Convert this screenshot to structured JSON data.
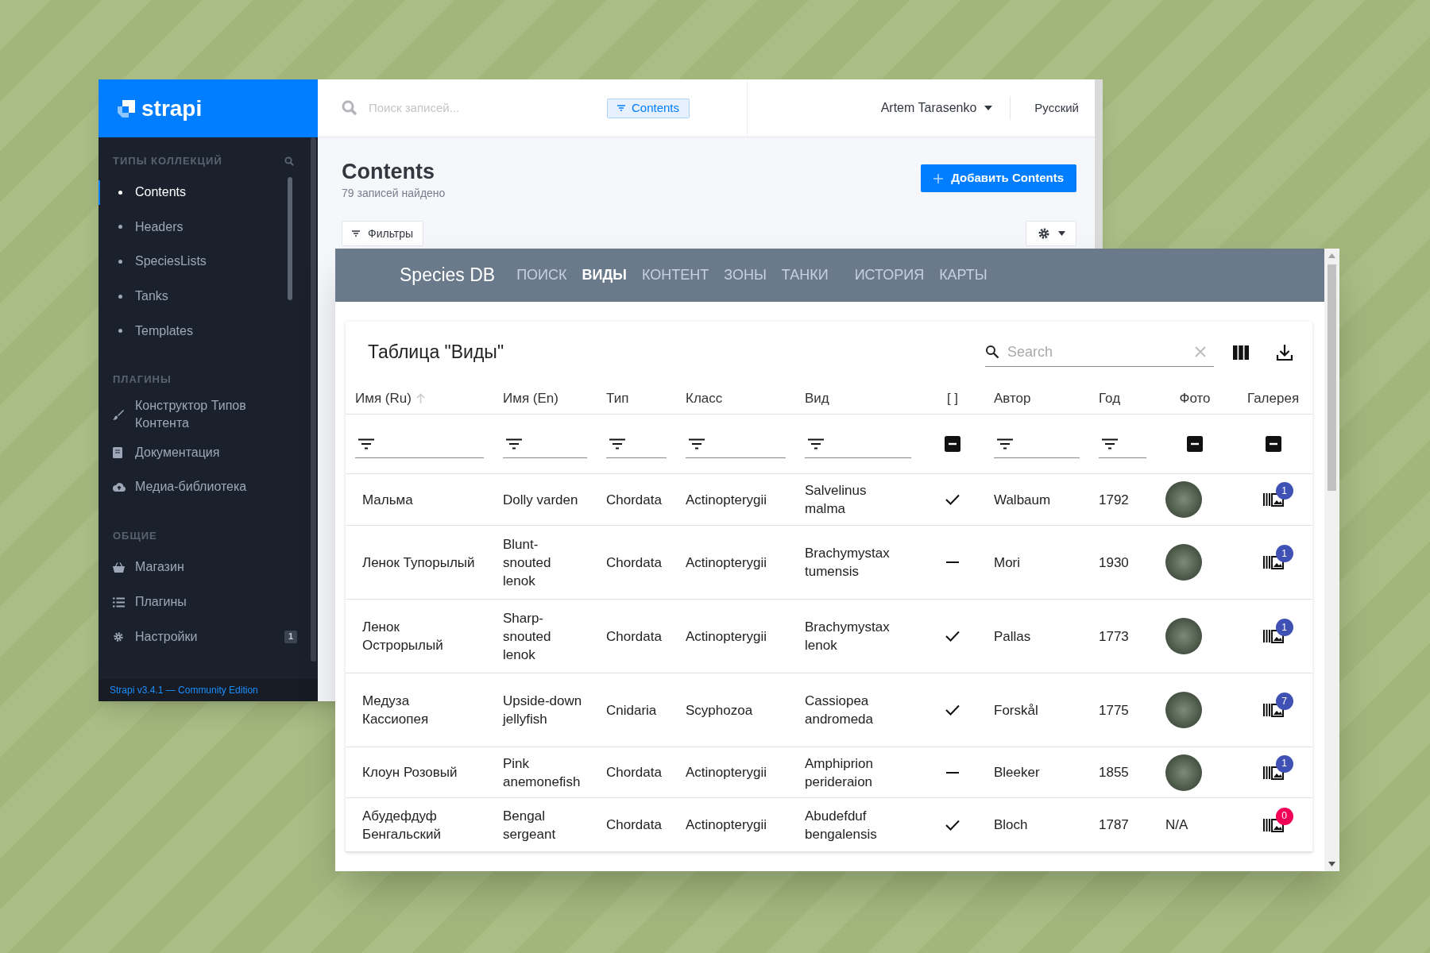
{
  "strapi": {
    "logo": "strapi",
    "sidebar": {
      "sections": [
        {
          "heading": "ТИПЫ КОЛЛЕКЦИЙ",
          "items": [
            {
              "label": "Contents",
              "kind": "bullet",
              "selected": true
            },
            {
              "label": "Headers",
              "kind": "bullet",
              "selected": false
            },
            {
              "label": "SpeciesLists",
              "kind": "bullet",
              "selected": false
            },
            {
              "label": "Tanks",
              "kind": "bullet",
              "selected": false
            },
            {
              "label": "Templates",
              "kind": "bullet",
              "selected": false
            }
          ]
        },
        {
          "heading": "ПЛАГИНЫ",
          "items": [
            {
              "label": "Конструктор Типов Контента",
              "kind": "icon",
              "selected": false
            },
            {
              "label": "Документация",
              "kind": "icon",
              "selected": false
            },
            {
              "label": "Медиа-библиотека",
              "kind": "icon",
              "selected": false
            }
          ]
        },
        {
          "heading": "ОБЩИЕ",
          "items": [
            {
              "label": "Магазин",
              "kind": "icon",
              "selected": false
            },
            {
              "label": "Плагины",
              "kind": "icon",
              "selected": false
            },
            {
              "label": "Настройки",
              "kind": "icon",
              "selected": false,
              "badge": "1"
            }
          ]
        }
      ],
      "footer": "Strapi v3.4.1 — Community Edition"
    },
    "topbar": {
      "search_placeholder": "Поиск записей...",
      "filter_chip": "Contents",
      "user": "Artem Tarasenko",
      "language": "Русский"
    },
    "page": {
      "title": "Contents",
      "subtitle": "79 записей найдено",
      "add_button": "Добавить Contents",
      "filters_button": "Фильтры"
    }
  },
  "species": {
    "brand": "Species DB",
    "nav": [
      {
        "label": "ПОИСК",
        "selected": false
      },
      {
        "label": "ВИДЫ",
        "selected": true
      },
      {
        "label": "КОНТЕНТ",
        "selected": false
      },
      {
        "label": "ЗОНЫ",
        "selected": false
      },
      {
        "label": "ТАНКИ",
        "selected": false
      },
      {
        "label": "ИСТОРИЯ",
        "selected": false
      },
      {
        "label": "КАРТЫ",
        "selected": false
      }
    ],
    "table": {
      "title": "Таблица \"Виды\"",
      "search_placeholder": "Search",
      "columns": [
        {
          "label": "Имя (Ru)",
          "sorted": true,
          "kind": "text"
        },
        {
          "label": "Имя (En)",
          "sorted": false,
          "kind": "text"
        },
        {
          "label": "Тип",
          "sorted": false,
          "kind": "text"
        },
        {
          "label": "Класс",
          "sorted": false,
          "kind": "text"
        },
        {
          "label": "Вид",
          "sorted": false,
          "kind": "text"
        },
        {
          "label": "[ ]",
          "sorted": false,
          "kind": "checkbox",
          "indeterminate": true
        },
        {
          "label": "Автор",
          "sorted": false,
          "kind": "text"
        },
        {
          "label": "Год",
          "sorted": false,
          "kind": "text"
        },
        {
          "label": "Фото",
          "sorted": false,
          "kind": "checkbox",
          "indeterminate": true
        },
        {
          "label": "Галерея",
          "sorted": false,
          "kind": "checkbox",
          "indeterminate": true
        }
      ],
      "rows": [
        {
          "name_ru": "Мальма",
          "name_en": "Dolly varden",
          "type": "Chordata",
          "class": "Actinopterygii",
          "species": "Salvelinus malma",
          "flag": true,
          "author": "Walbaum",
          "year": "1792",
          "photo": {
            "kind": "image"
          },
          "gallery": {
            "count": "1",
            "color": "#3f51b5"
          }
        },
        {
          "name_ru": "Ленок Тупорылый",
          "name_en": "Blunt-snouted lenok",
          "type": "Chordata",
          "class": "Actinopterygii",
          "species": "Brachymystax tumensis",
          "flag": false,
          "author": "Mori",
          "year": "1930",
          "photo": {
            "kind": "image"
          },
          "gallery": {
            "count": "1",
            "color": "#3f51b5"
          }
        },
        {
          "name_ru": "Ленок Острорылый",
          "name_en": "Sharp-snouted lenok",
          "type": "Chordata",
          "class": "Actinopterygii",
          "species": "Brachymystax lenok",
          "flag": true,
          "author": "Pallas",
          "year": "1773",
          "photo": {
            "kind": "image"
          },
          "gallery": {
            "count": "1",
            "color": "#3f51b5"
          }
        },
        {
          "name_ru": "Медуза Кассиопея",
          "name_en": "Upside-down jellyfish",
          "type": "Cnidaria",
          "class": "Scyphozoa",
          "species": "Cassiopea andromeda",
          "flag": true,
          "author": "Forskål",
          "year": "1775",
          "photo": {
            "kind": "image"
          },
          "gallery": {
            "count": "7",
            "color": "#3f51b5"
          }
        },
        {
          "name_ru": "Клоун Розовый",
          "name_en": "Pink anemonefish",
          "type": "Chordata",
          "class": "Actinopterygii",
          "species": "Amphiprion perideraion",
          "flag": false,
          "author": "Bleeker",
          "year": "1855",
          "photo": {
            "kind": "image"
          },
          "gallery": {
            "count": "1",
            "color": "#3f51b5"
          }
        },
        {
          "name_ru": "Абудефдуф Бенгальский",
          "name_en": "Bengal sergeant",
          "type": "Chordata",
          "class": "Actinopterygii",
          "species": "Abudefduf bengalensis",
          "flag": true,
          "author": "Bloch",
          "year": "1787",
          "photo": {
            "kind": "text",
            "text": "N/A"
          },
          "gallery": {
            "count": "0",
            "color": "#f50057"
          }
        }
      ]
    }
  }
}
